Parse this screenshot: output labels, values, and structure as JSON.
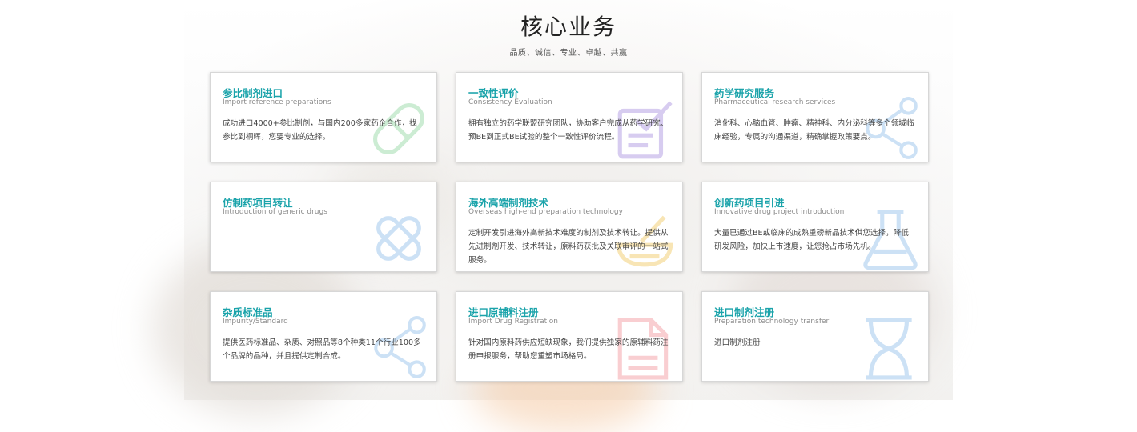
{
  "header": {
    "title": "核心业务",
    "subtitle": "品质、诚信、专业、卓越、共赢"
  },
  "cards": [
    {
      "title": "参比制剂进口",
      "subtitle": "Import reference preparations",
      "desc": "成功进口4000+参比制剂，与国内200多家药企合作，找参比到桐晖，您要专业的选择。",
      "icon": "capsule-icon",
      "color": "#8fd6a0"
    },
    {
      "title": "一致性评价",
      "subtitle": "Consistency Evaluation",
      "desc": "拥有独立的药学联盟研究团队，协助客户完成从药学研究、预BE到正式BE试验的整个一致性评价流程。",
      "icon": "clipboard-check-icon",
      "color": "#a88fe0"
    },
    {
      "title": "药学研究服务",
      "subtitle": "Pharmaceutical research services",
      "desc": "消化科、心脑血管、肿瘤、精神科、内分泌科等多个领域临床经验，专属的沟通渠道，精确掌握政策要点。",
      "icon": "molecule-icon",
      "color": "#8fbdea"
    },
    {
      "title": "仿制药项目转让",
      "subtitle": "Introduction of generic drugs",
      "desc": "",
      "icon": "pills-cross-icon",
      "color": "#8fbdea"
    },
    {
      "title": "海外高端制剂技术",
      "subtitle": "Overseas high-end preparation technology",
      "desc": "定制开发引进海外高新技术难度的制剂及技术转让。提供从先进制剂开发、技术转让，原料药获批及关联审评的一站式服务。",
      "icon": "mortar-pestle-icon",
      "color": "#f0c65c"
    },
    {
      "title": "创新药项目引进",
      "subtitle": "Innovative drug project introduction",
      "desc": "大量已通过BE或临床的成熟重磅新品技术供您选择，降低研发风险，加快上市速度，让您抢占市场先机。",
      "icon": "flask-icon",
      "color": "#8fbdea"
    },
    {
      "title": "杂质标准品",
      "subtitle": "Impurity/Standard",
      "desc": "提供医药标准品、杂质、对照品等8个种类11个行业100多个品牌的品种，并且提供定制合成。",
      "icon": "molecule-icon",
      "color": "#8fbdea"
    },
    {
      "title": "进口原辅料注册",
      "subtitle": "Import Drug Registration",
      "desc": "针对国内原料药供应短缺现象，我们提供独家的原辅料药注册申报服务，帮助您重塑市场格局。",
      "icon": "document-icon",
      "color": "#f2939a"
    },
    {
      "title": "进口制剂注册",
      "subtitle": "Preparation technology transfer",
      "desc": "进口制剂注册",
      "icon": "hourglass-icon",
      "color": "#8fbdea"
    }
  ]
}
